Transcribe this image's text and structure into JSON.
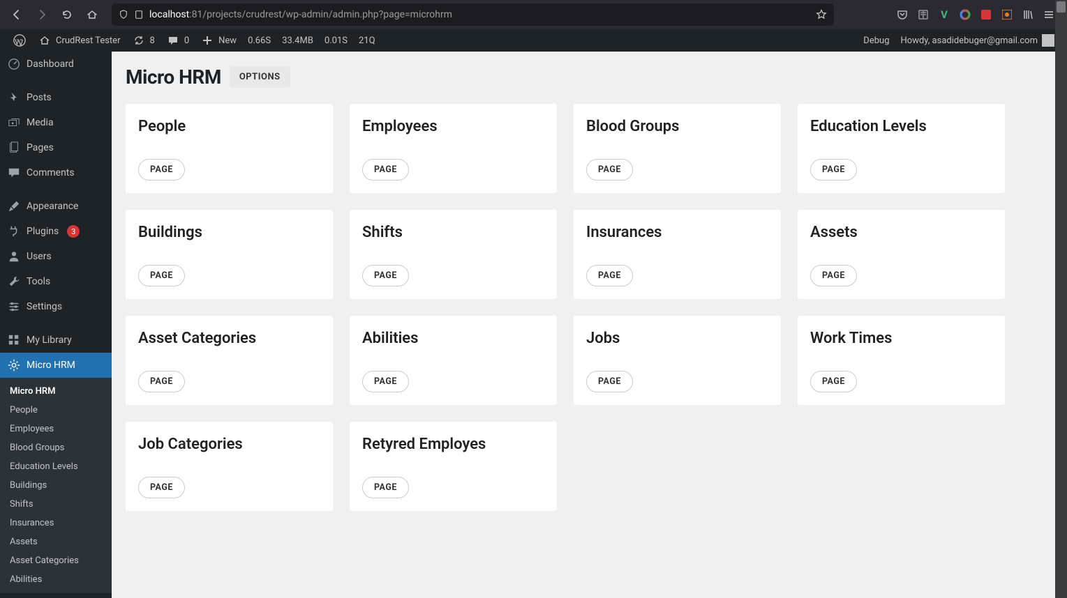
{
  "browser": {
    "url_host": "localhost",
    "url_port": ":81",
    "url_path": "/projects/crudrest/wp-admin/admin.php?page=microhrm"
  },
  "adminbar": {
    "site_name": "CrudRest Tester",
    "updates": "8",
    "comments": "0",
    "new_label": "New",
    "perf_time": "0.66S",
    "perf_mem": "33.4MB",
    "perf_db": "0.01S",
    "perf_q": "21Q",
    "debug": "Debug",
    "howdy": "Howdy, asadidebuger@gmail.com"
  },
  "sidebar": {
    "items": [
      {
        "label": "Dashboard"
      },
      {
        "label": "Posts"
      },
      {
        "label": "Media"
      },
      {
        "label": "Pages"
      },
      {
        "label": "Comments"
      },
      {
        "label": "Appearance"
      },
      {
        "label": "Plugins",
        "badge": "3"
      },
      {
        "label": "Users"
      },
      {
        "label": "Tools"
      },
      {
        "label": "Settings"
      },
      {
        "label": "My Library"
      },
      {
        "label": "Micro HRM"
      }
    ],
    "submenu": [
      "Micro HRM",
      "People",
      "Employees",
      "Blood Groups",
      "Education Levels",
      "Buildings",
      "Shifts",
      "Insurances",
      "Assets",
      "Asset Categories",
      "Abilities"
    ]
  },
  "page": {
    "title": "Micro HRM",
    "options_label": "OPTIONS",
    "page_btn_label": "PAGE",
    "cards": [
      "People",
      "Employees",
      "Blood Groups",
      "Education Levels",
      "Buildings",
      "Shifts",
      "Insurances",
      "Assets",
      "Asset Categories",
      "Abilities",
      "Jobs",
      "Work Times",
      "Job Categories",
      "Retyred Employes"
    ]
  }
}
